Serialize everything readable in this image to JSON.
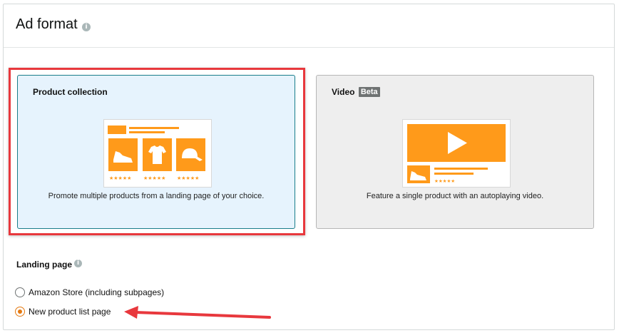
{
  "section": {
    "title": "Ad format",
    "info_symbol": "i"
  },
  "formats": [
    {
      "title": "Product collection",
      "description": "Promote multiple products from a landing page of your choice.",
      "selected": true
    },
    {
      "title": "Video",
      "badge": "Beta",
      "description": "Feature a single product with an autoplaying video.",
      "selected": false
    }
  ],
  "landing_page": {
    "label": "Landing page",
    "info_symbol": "i",
    "options": [
      {
        "label": "Amazon Store (including subpages)",
        "checked": false
      },
      {
        "label": "New product list page",
        "checked": true
      }
    ]
  },
  "colors": {
    "accent_orange": "#ff9a1a",
    "highlight_red": "#e8383d",
    "selected_card_bg": "#e6f3fd",
    "selected_card_border": "#1a7d8a",
    "radio_selected": "#e47911"
  }
}
